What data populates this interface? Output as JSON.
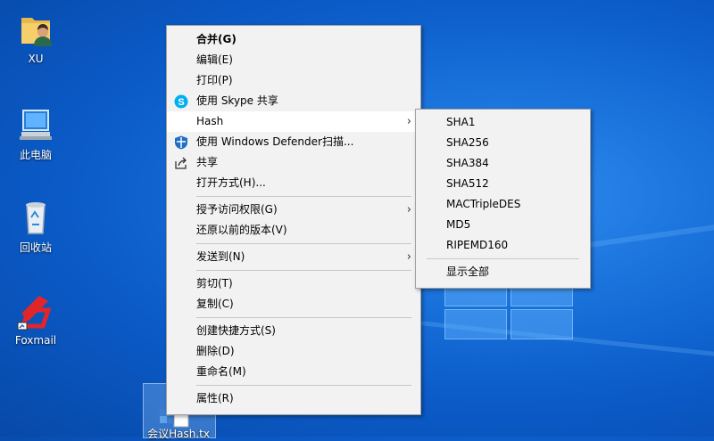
{
  "desktop": {
    "icons": [
      {
        "label": "XU",
        "icon": "user-folder-icon"
      },
      {
        "label": "此电脑",
        "icon": "computer-icon"
      },
      {
        "label": "回收站",
        "icon": "recycle-bin-icon"
      },
      {
        "label": "Foxmail",
        "icon": "foxmail-icon"
      }
    ],
    "selected_file_label": "会议Hash.tx"
  },
  "context_menu": {
    "items": [
      {
        "label": "合并(G)"
      },
      {
        "label": "编辑(E)"
      },
      {
        "label": "打印(P)"
      },
      {
        "label": "使用 Skype 共享",
        "icon": "skype-icon"
      },
      {
        "label": "Hash"
      },
      {
        "label": "使用 Windows Defender扫描...",
        "icon": "windows-defender-icon"
      },
      {
        "label": "共享",
        "icon": "share-icon"
      },
      {
        "label": "打开方式(H)..."
      },
      {
        "label": "授予访问权限(G)"
      },
      {
        "label": "还原以前的版本(V)"
      },
      {
        "label": "发送到(N)"
      },
      {
        "label": "剪切(T)"
      },
      {
        "label": "复制(C)"
      },
      {
        "label": "创建快捷方式(S)"
      },
      {
        "label": "删除(D)"
      },
      {
        "label": "重命名(M)"
      },
      {
        "label": "属性(R)"
      }
    ]
  },
  "hash_submenu": {
    "items": [
      "SHA1",
      "SHA256",
      "SHA384",
      "SHA512",
      "MACTripleDES",
      "MD5",
      "RIPEMD160"
    ],
    "show_all": "显示全部"
  },
  "colors": {
    "menu_bg": "#f2f2f2",
    "menu_hover": "#ffffff",
    "desktop_blue": "#0b5bc8",
    "skype_blue": "#00aff0",
    "foxmail_red": "#e0262b"
  }
}
